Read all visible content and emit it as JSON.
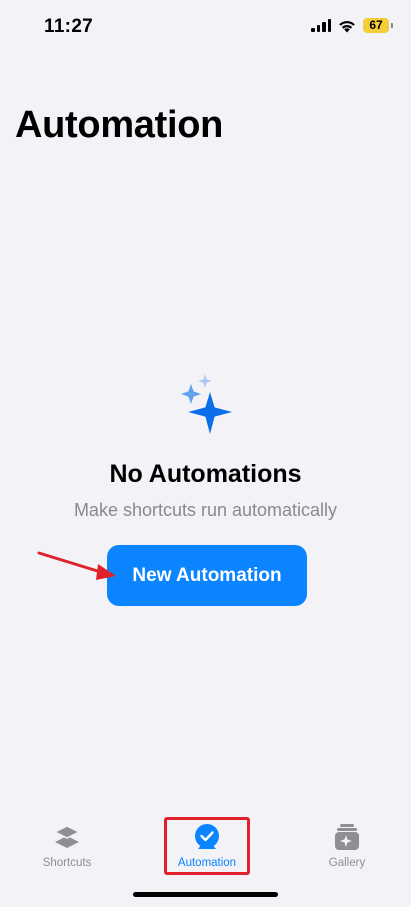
{
  "status_bar": {
    "time": "11:27",
    "battery_level": "67",
    "battery_color": "#f5cf3a"
  },
  "header": {
    "title": "Automation"
  },
  "empty_state": {
    "icon": "sparkles-icon",
    "title": "No Automations",
    "subtitle": "Make shortcuts run automatically",
    "button_label": "New Automation"
  },
  "tabs": [
    {
      "label": "Shortcuts",
      "icon": "layers-icon",
      "active": false
    },
    {
      "label": "Automation",
      "icon": "clock-check-icon",
      "active": true
    },
    {
      "label": "Gallery",
      "icon": "gallery-sparkle-icon",
      "active": false
    }
  ],
  "colors": {
    "accent": "#0a84ff",
    "background": "#f2f2f7",
    "annotation": "#e0202a",
    "inactive_tab": "#8e8e93"
  }
}
